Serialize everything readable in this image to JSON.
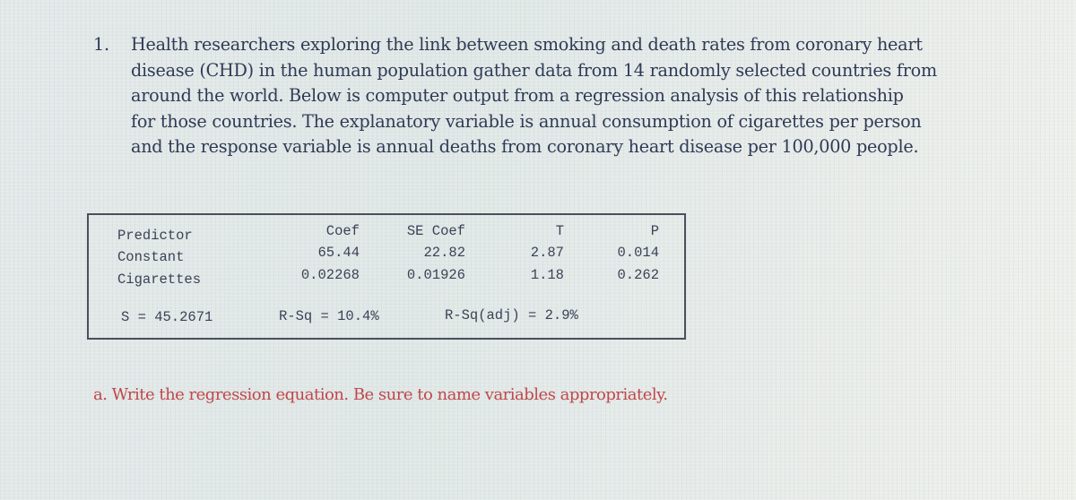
{
  "question": {
    "number": "1.",
    "lines": [
      "Health researchers exploring the link between smoking and death rates from coronary heart",
      "disease (CHD) in the human population gather data from 14 randomly selected countries from",
      "around the world.  Below is computer output from a regression analysis of this relationship",
      "for those countries.  The explanatory variable is annual consumption of cigarettes per person",
      "and the response variable is annual deaths from coronary heart disease per 100,000 people."
    ]
  },
  "regression_output": {
    "headers": [
      "Predictor",
      "Coef",
      "SE Coef",
      "T",
      "P"
    ],
    "rows": [
      [
        "Constant",
        "65.44",
        "22.82",
        "2.87",
        "0.014"
      ],
      [
        "Cigarettes",
        "0.02268",
        "0.01926",
        "1.18",
        "0.262"
      ]
    ],
    "summary": {
      "s": "S = 45.2671",
      "rsq": "R-Sq = 10.4%",
      "rsq_adj": "R-Sq(adj) = 2.9%"
    }
  },
  "part_a": "a. Write the regression equation.  Be sure to name variables appropriately."
}
